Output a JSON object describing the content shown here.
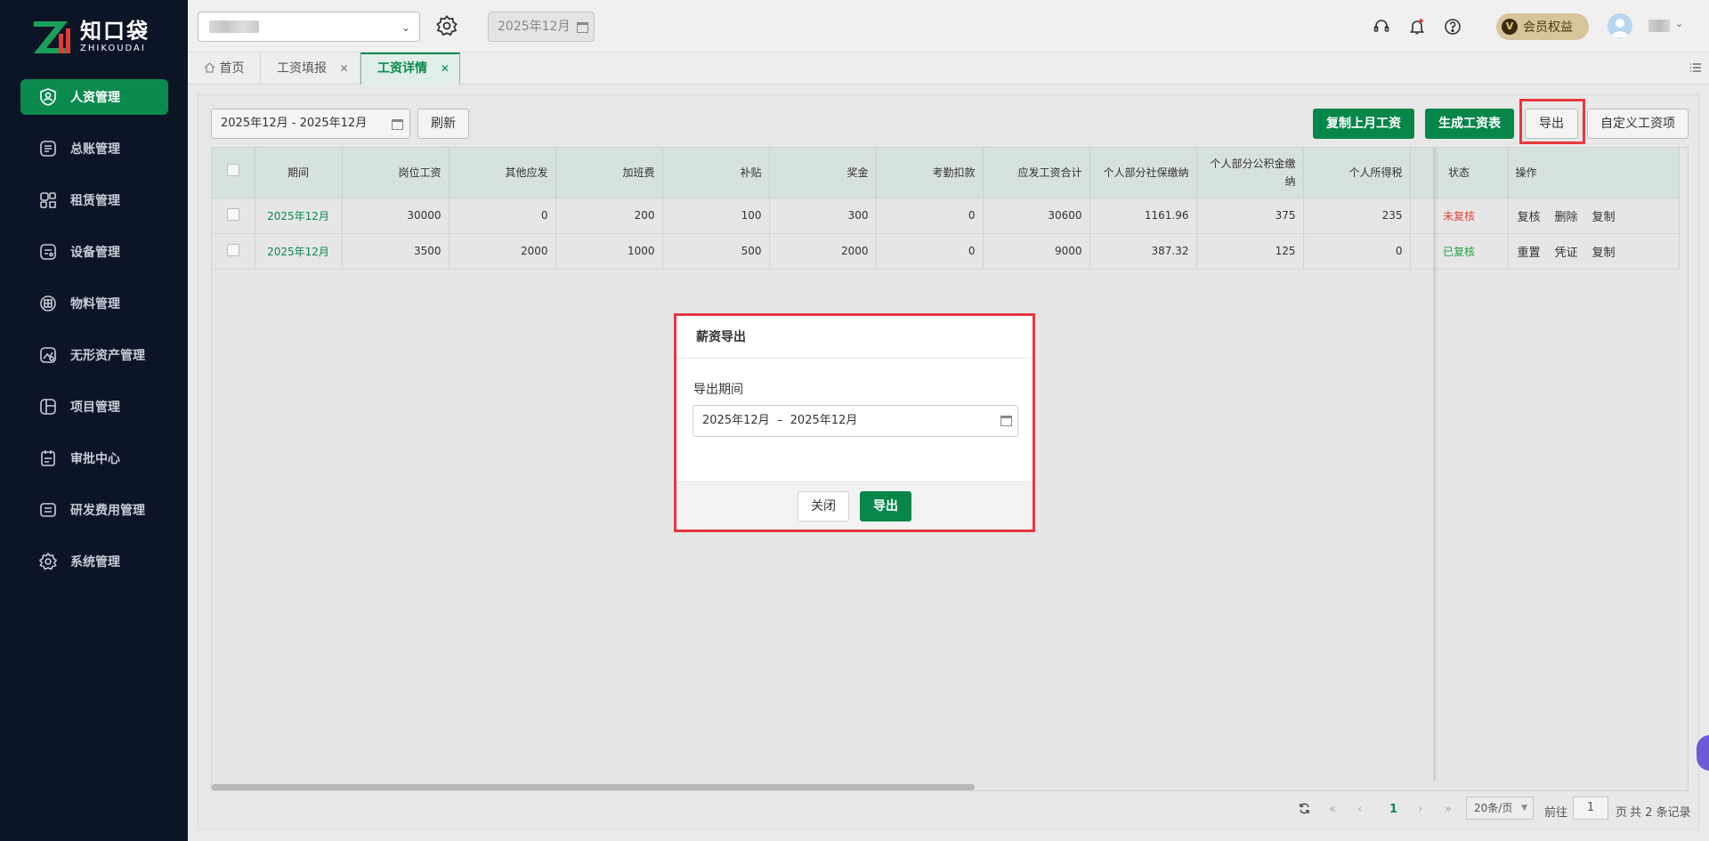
{
  "logo": {
    "cn": "知口袋",
    "en": "ZHIKOUDAI"
  },
  "sidebar": {
    "items": [
      {
        "label": "人资管理",
        "icon": "user-shield-icon",
        "active": true
      },
      {
        "label": "总账管理",
        "icon": "ledger-icon"
      },
      {
        "label": "租赁管理",
        "icon": "lease-icon"
      },
      {
        "label": "设备管理",
        "icon": "device-icon"
      },
      {
        "label": "物料管理",
        "icon": "material-icon"
      },
      {
        "label": "无形资产管理",
        "icon": "intangible-asset-icon"
      },
      {
        "label": "项目管理",
        "icon": "project-icon"
      },
      {
        "label": "审批中心",
        "icon": "approval-icon"
      },
      {
        "label": "研发费用管理",
        "icon": "rd-expense-icon"
      },
      {
        "label": "系统管理",
        "icon": "settings-icon"
      }
    ]
  },
  "header": {
    "period": "2025年12月",
    "member_label": "会员权益",
    "member_badge": "V"
  },
  "tabs": [
    {
      "label": "首页",
      "closable": false
    },
    {
      "label": "工资填报",
      "closable": true
    },
    {
      "label": "工资详情",
      "closable": true,
      "active": true
    }
  ],
  "toolbar": {
    "date_range": "2025年12月 - 2025年12月",
    "refresh": "刷新",
    "copy_last_month": "复制上月工资",
    "generate_payroll": "生成工资表",
    "export": "导出",
    "custom_items": "自定义工资项"
  },
  "table": {
    "headers": [
      "期间",
      "岗位工资",
      "其他应发",
      "加班费",
      "补贴",
      "奖金",
      "考勤扣款",
      "应发工资合计",
      "个人部分社保缴纳",
      "个人部分公积金缴纳",
      "个人所得税",
      "状态",
      "操作"
    ],
    "rows": [
      {
        "period": "2025年12月",
        "post_salary": "30000",
        "other": "0",
        "overtime": "200",
        "subsidy": "100",
        "bonus": "300",
        "attendance_deduction": "0",
        "gross_total": "30600",
        "social_security": "1161.96",
        "housing_fund": "375",
        "income_tax": "235",
        "status": "未复核",
        "actions": [
          "复核",
          "删除",
          "复制"
        ]
      },
      {
        "period": "2025年12月",
        "post_salary": "3500",
        "other": "2000",
        "overtime": "1000",
        "subsidy": "500",
        "bonus": "2000",
        "attendance_deduction": "0",
        "gross_total": "9000",
        "social_security": "387.32",
        "housing_fund": "125",
        "income_tax": "0",
        "status": "已复核",
        "actions": [
          "重置",
          "凭证",
          "复制"
        ]
      }
    ]
  },
  "pagination": {
    "current_page": "1",
    "page_size": "20条/页",
    "goto_label": "前往",
    "goto_value": "1",
    "page_unit": "页",
    "total": "共 2 条记录"
  },
  "dialog": {
    "title": "薪资导出",
    "field_label": "导出期间",
    "field_value": "2025年12月  –  2025年12月",
    "close": "关闭",
    "confirm": "导出"
  },
  "colors": {
    "brand": "#07864a",
    "sidebar": "#0c1526",
    "highlight": "#e8373e",
    "status_unreviewed": "#e2453c",
    "status_reviewed": "#28a044"
  }
}
